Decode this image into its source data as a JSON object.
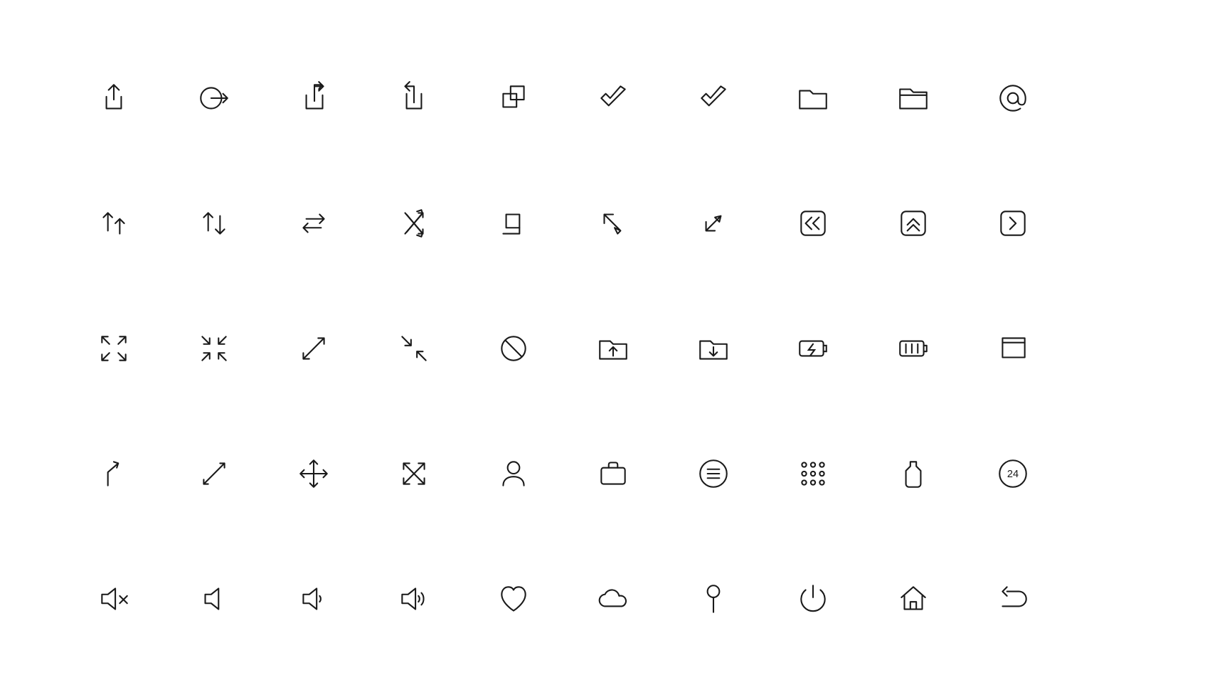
{
  "grid": {
    "rows": 5,
    "cols": 11
  },
  "icons": [
    [
      "share-up",
      "exit-right",
      "export-right",
      "import-left",
      "copy-overlap",
      "check-outline",
      "check",
      "folder",
      "folder-tab",
      "at-sign"
    ],
    [
      "arrows-up-up",
      "arrows-up-down",
      "arrows-swap-horizontal",
      "shuffle-cross",
      "crop-square",
      "arrow-top-left-box",
      "arrow-bottom-left-box",
      "rewind-box",
      "chevrons-up-box",
      "chevron-right-box"
    ],
    [
      "expand-corners",
      "collapse-corners",
      "expand-diagonal",
      "collapse-diagonal",
      "ban",
      "folder-upload",
      "folder-download",
      "battery-charging",
      "battery-bars",
      "window-stack"
    ],
    [
      "turn-up-right",
      "resize-diagonal",
      "move-cross",
      "expand-x",
      "user",
      "briefcase",
      "list-circle",
      "dialpad-grid",
      "bottle-tag",
      "24-circle"
    ],
    [
      "speaker-mute",
      "speaker-off",
      "speaker-low",
      "speaker-high",
      "heart",
      "cloud",
      "pin-round",
      "power",
      "home",
      "undo"
    ]
  ],
  "labels": {
    "badge_24": "24"
  },
  "colors": {
    "stroke": "#1a1a1a",
    "background": "#ffffff"
  }
}
